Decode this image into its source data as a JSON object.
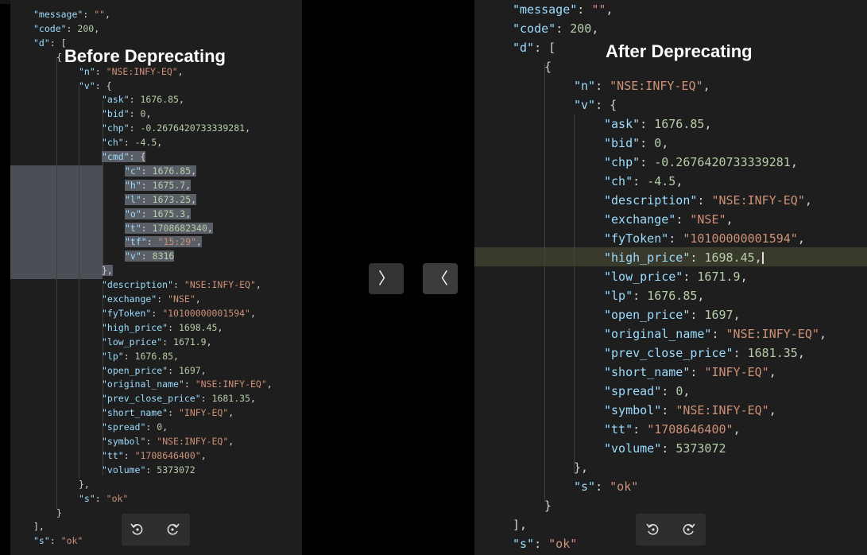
{
  "labels": {
    "before": "Before Deprecating",
    "after": "After Deprecating"
  },
  "navigation": {
    "next_glyph": "〉",
    "prev_glyph": "〈"
  },
  "icons": {
    "rotate_left": "rotate-left-icon",
    "rotate_right": "rotate-right-icon"
  },
  "colors": {
    "background": "#1e1e1e",
    "key": "#9cdcfe",
    "string": "#ce9178",
    "number": "#b5cea8",
    "punctuation": "#d4d4d4"
  },
  "before_code": [
    "\"message\": \"\",",
    "\"code\": 200,",
    "\"d\": [",
    "{",
    "\"n\": \"NSE:INFY-EQ\",",
    "\"v\": {",
    "\"ask\": 1676.85,",
    "\"bid\": 0,",
    "\"chp\": -0.2676420733339281,",
    "\"ch\": -4.5,",
    "\"cmd\": {",
    "\"c\": 1676.85,",
    "\"h\": 1675.7,",
    "\"l\": 1673.25,",
    "\"o\": 1675.3,",
    "\"t\": 1708682340,",
    "\"tf\": \"15:29\",",
    "\"v\": 8316",
    "},",
    "\"description\": \"NSE:INFY-EQ\",",
    "\"exchange\": \"NSE\",",
    "\"fyToken\": \"10100000001594\",",
    "\"high_price\": 1698.45,",
    "\"low_price\": 1671.9,",
    "\"lp\": 1676.85,",
    "\"open_price\": 1697,",
    "\"original_name\": \"NSE:INFY-EQ\",",
    "\"prev_close_price\": 1681.35,",
    "\"short_name\": \"INFY-EQ\",",
    "\"spread\": 0,",
    "\"symbol\": \"NSE:INFY-EQ\",",
    "\"tt\": \"1708646400\",",
    "\"volume\": 5373072",
    "},",
    "\"s\": \"ok\"",
    "}",
    "],",
    "\"s\": \"ok\""
  ],
  "after_code": [
    "\"message\": \"\",",
    "\"code\": 200,",
    "\"d\": [",
    "{",
    "\"n\": \"NSE:INFY-EQ\",",
    "\"v\": {",
    "\"ask\": 1676.85,",
    "\"bid\": 0,",
    "\"chp\": -0.2676420733339281,",
    "\"ch\": -4.5,",
    "\"description\": \"NSE:INFY-EQ\",",
    "\"exchange\": \"NSE\",",
    "\"fyToken\": \"10100000001594\",",
    "\"high_price\": 1698.45,",
    "\"low_price\": 1671.9,",
    "\"lp\": 1676.85,",
    "\"open_price\": 1697,",
    "\"original_name\": \"NSE:INFY-EQ\",",
    "\"prev_close_price\": 1681.35,",
    "\"short_name\": \"INFY-EQ\",",
    "\"spread\": 0,",
    "\"symbol\": \"NSE:INFY-EQ\",",
    "\"tt\": \"1708646400\",",
    "\"volume\": 5373072",
    "},",
    "\"s\": \"ok\"",
    "}",
    "],",
    "\"s\": \"ok\""
  ]
}
